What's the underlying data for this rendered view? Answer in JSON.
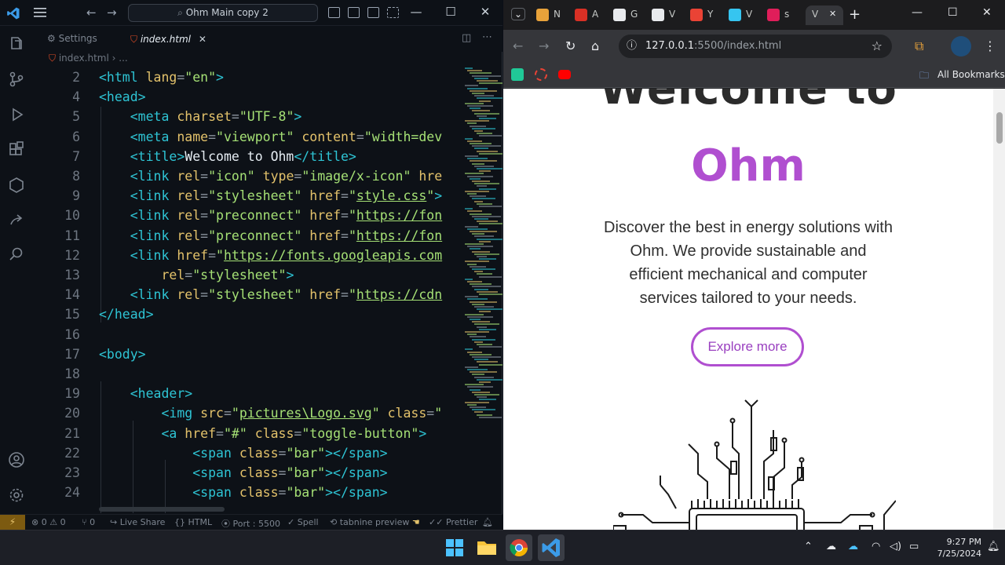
{
  "vscode": {
    "search_text": "Ohm Main copy 2",
    "tabs": [
      {
        "label": "Settings",
        "icon": "gear-icon",
        "active": false
      },
      {
        "label": "index.html",
        "icon": "html5-icon",
        "active": true
      }
    ],
    "breadcrumb": [
      "index.html",
      "..."
    ],
    "code_lines": [
      {
        "n": "2",
        "html": "<span class='tag'>&lt;html</span> <span class='attr'>lang</span><span class='punc'>=</span><span class='str'>\"en\"</span><span class='tag'>&gt;</span>"
      },
      {
        "n": "4",
        "html": "<span class='tag'>&lt;head&gt;</span>"
      },
      {
        "n": "5",
        "html": "    <span class='tag'>&lt;meta</span> <span class='attr'>charset</span><span class='punc'>=</span><span class='str'>\"UTF-8\"</span><span class='tag'>&gt;</span>"
      },
      {
        "n": "6",
        "html": "    <span class='tag'>&lt;meta</span> <span class='attr'>name</span><span class='punc'>=</span><span class='str'>\"viewport\"</span> <span class='attr'>content</span><span class='punc'>=</span><span class='str'>\"width=dev</span>"
      },
      {
        "n": "7",
        "html": "    <span class='tag'>&lt;title&gt;</span><span class='txt'>Welcome to Ohm</span><span class='tag'>&lt;/title&gt;</span>"
      },
      {
        "n": "8",
        "html": "    <span class='tag'>&lt;link</span> <span class='attr'>rel</span><span class='punc'>=</span><span class='str'>\"icon\"</span> <span class='attr'>type</span><span class='punc'>=</span><span class='str'>\"image/x-icon\"</span> <span class='attr'>hre</span>"
      },
      {
        "n": "9",
        "html": "    <span class='tag'>&lt;link</span> <span class='attr'>rel</span><span class='punc'>=</span><span class='str'>\"stylesheet\"</span> <span class='attr'>href</span><span class='punc'>=</span><span class='str'>\"</span><span class='link'>style.css</span><span class='str'>\"</span><span class='tag'>&gt;</span>"
      },
      {
        "n": "10",
        "html": "    <span class='tag'>&lt;link</span> <span class='attr'>rel</span><span class='punc'>=</span><span class='str'>\"preconnect\"</span> <span class='attr'>href</span><span class='punc'>=</span><span class='str'>\"</span><span class='link'>https://fon</span>"
      },
      {
        "n": "11",
        "html": "    <span class='tag'>&lt;link</span> <span class='attr'>rel</span><span class='punc'>=</span><span class='str'>\"preconnect\"</span> <span class='attr'>href</span><span class='punc'>=</span><span class='str'>\"</span><span class='link'>https://fon</span>"
      },
      {
        "n": "12",
        "html": "    <span class='tag'>&lt;link</span> <span class='attr'>href</span><span class='punc'>=</span><span class='str'>\"</span><span class='link'>https://fonts.googleapis.com</span>"
      },
      {
        "n": "13",
        "html": "        <span class='attr'>rel</span><span class='punc'>=</span><span class='str'>\"stylesheet\"</span><span class='tag'>&gt;</span>"
      },
      {
        "n": "14",
        "html": "    <span class='tag'>&lt;link</span> <span class='attr'>rel</span><span class='punc'>=</span><span class='str'>\"stylesheet\"</span> <span class='attr'>href</span><span class='punc'>=</span><span class='str'>\"</span><span class='link'>https://cdn</span>"
      },
      {
        "n": "15",
        "html": "<span class='tag'>&lt;/head&gt;</span>"
      },
      {
        "n": "16",
        "html": ""
      },
      {
        "n": "17",
        "html": "<span class='tag'>&lt;body&gt;</span>"
      },
      {
        "n": "18",
        "html": ""
      },
      {
        "n": "19",
        "html": "    <span class='tag'>&lt;header&gt;</span>"
      },
      {
        "n": "20",
        "html": "        <span class='tag'>&lt;img</span> <span class='attr'>src</span><span class='punc'>=</span><span class='str'>\"</span><span class='link'>pictures\\Logo.svg</span><span class='str'>\"</span> <span class='attr'>class</span><span class='punc'>=</span><span class='str'>\"</span>"
      },
      {
        "n": "21",
        "html": "        <span class='tag'>&lt;a</span> <span class='attr'>href</span><span class='punc'>=</span><span class='str'>\"#\"</span> <span class='attr'>class</span><span class='punc'>=</span><span class='str'>\"toggle-button\"</span><span class='tag'>&gt;</span>"
      },
      {
        "n": "22",
        "html": "            <span class='tag'>&lt;span</span> <span class='attr'>class</span><span class='punc'>=</span><span class='str'>\"bar\"</span><span class='tag'>&gt;&lt;/span&gt;</span>"
      },
      {
        "n": "23",
        "html": "            <span class='tag'>&lt;span</span> <span class='attr'>class</span><span class='punc'>=</span><span class='str'>\"bar\"</span><span class='tag'>&gt;&lt;/span&gt;</span>"
      },
      {
        "n": "24",
        "html": "            <span class='tag'>&lt;span</span> <span class='attr'>class</span><span class='punc'>=</span><span class='str'>\"bar\"</span><span class='tag'>&gt;&lt;/span&gt;</span>"
      }
    ],
    "status": {
      "remote": "⚡",
      "problems": "⊗ 0 ⚠ 0",
      "ports_count": "⑂ 0",
      "live_share": "Live Share",
      "language": "HTML",
      "port": "Port : 5500",
      "spell": "Spell",
      "tabnine": "tabnine preview",
      "prettier": "Prettier"
    }
  },
  "chrome": {
    "tabs": [
      {
        "label": "N",
        "icon": "chrome-tab-icon",
        "color": "#e8a23a"
      },
      {
        "label": "A",
        "icon": "h-app-icon",
        "color": "#d93025"
      },
      {
        "label": "G",
        "icon": "github-icon",
        "color": "#e8eaed"
      },
      {
        "label": "V",
        "icon": "globe-icon",
        "color": "#e8eaed"
      },
      {
        "label": "Y",
        "icon": "gmail-icon",
        "color": "#ea4335"
      },
      {
        "label": "V",
        "icon": "slack-icon",
        "color": "#36c5f0"
      },
      {
        "label": "s",
        "icon": "slack-icon",
        "color": "#e01e5a"
      },
      {
        "label": "V",
        "icon": "",
        "color": "",
        "active": true
      }
    ],
    "url_host": "127.0.0.1",
    "url_rest": ":5500/index.html",
    "all_bookmarks": "All Bookmarks",
    "page": {
      "heading_line1": "Welcome to",
      "heading_brand": "Ohm",
      "description": "Discover the best in energy solutions with Ohm. We provide sustainable and efficient mechanical and computer services tailored to your needs.",
      "cta": "Explore more",
      "brand_color": "#b04fd0"
    }
  },
  "taskbar": {
    "time": "9:27 PM",
    "date": "7/25/2024"
  }
}
